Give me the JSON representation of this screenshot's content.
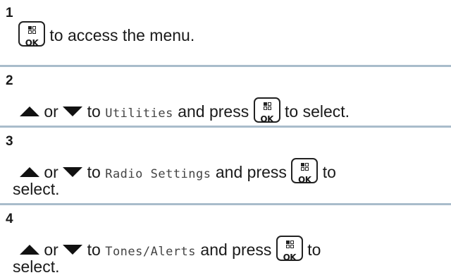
{
  "steps": [
    {
      "number": "1",
      "line1_after_key": "to access the menu."
    },
    {
      "number": "2",
      "or_text": "or",
      "to_text": "to",
      "menu_item": "Utilities",
      "press_text": "and press",
      "after_key": "to select."
    },
    {
      "number": "3",
      "or_text": "or",
      "to_text": "to",
      "menu_item": "Radio Settings",
      "press_text": "and press",
      "after_key": "to",
      "line2": "select."
    },
    {
      "number": "4",
      "or_text": "or",
      "to_text": "to",
      "menu_item": "Tones/Alerts",
      "press_text": "and press",
      "after_key": "to",
      "line2": "select."
    }
  ],
  "key_label": "OK",
  "icons": {
    "ok_key": "menu-ok-key-icon",
    "up": "up-arrow-icon",
    "down": "down-arrow-icon"
  },
  "colors": {
    "divider": "#a9bccb",
    "text": "#1a1a1a"
  }
}
